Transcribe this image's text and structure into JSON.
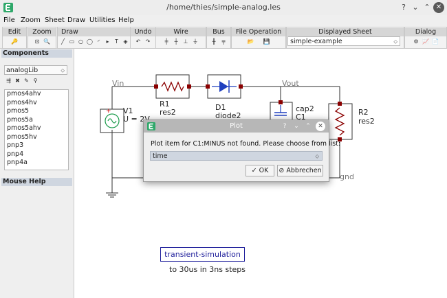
{
  "window": {
    "title": "/home/thies/simple-analog.les"
  },
  "menu": [
    "File",
    "Zoom",
    "Sheet",
    "Draw",
    "Utilities",
    "Help"
  ],
  "toolbar": {
    "groups": [
      {
        "title": "Edit"
      },
      {
        "title": "Zoom"
      },
      {
        "title": "Draw"
      },
      {
        "title": "Undo"
      },
      {
        "title": "Wire"
      },
      {
        "title": "Bus"
      },
      {
        "title": "File Operation"
      },
      {
        "title": "Displayed Sheet"
      },
      {
        "title": "Dialog"
      }
    ],
    "displayed_sheet_value": "simple-example"
  },
  "components_panel": {
    "title": "Components",
    "library": "analogLib",
    "items": [
      "pmos4ahv",
      "pmos4hv",
      "pmos5",
      "pmos5a",
      "pmos5ahv",
      "pmos5hv",
      "pnp3",
      "pnp4",
      "pnp4a"
    ]
  },
  "mouse_help": {
    "title": "Mouse Help"
  },
  "schematic": {
    "labels": {
      "vin": "Vin",
      "vout": "Vout",
      "gnd": "gnd",
      "r1_name": "R1",
      "r1_type": "res2",
      "d1_name": "D1",
      "d1_type": "diode2",
      "v1_name": "V1",
      "v1_value": "U = 2V",
      "c1_type": "cap2",
      "c1_name": "C1",
      "r2_name": "R2",
      "r2_type": "res2"
    },
    "sim_label": "transient-simulation",
    "sim_subtitle": "to 30us in 3ns steps"
  },
  "dialog": {
    "title": "Plot",
    "message": "Plot item for C1:MINUS not found. Please choose from list:",
    "selected": "time",
    "ok_label": "OK",
    "cancel_label": "Abbrechen"
  },
  "colors": {
    "wire": "#2c2c2c",
    "pin": "#8b0000",
    "resistor": "#8b0000",
    "diode": "#1f3fbf",
    "capacitor": "#1f3fbf",
    "source": "#1a9a4a"
  }
}
